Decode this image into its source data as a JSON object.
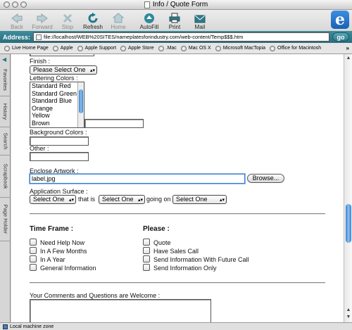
{
  "window": {
    "title": "Info / Quote Form"
  },
  "toolbar": {
    "back": "Back",
    "forward": "Forward",
    "stop": "Stop",
    "refresh": "Refresh",
    "home": "Home",
    "autofill": "AutoFill",
    "print": "Print",
    "mail": "Mail"
  },
  "address": {
    "label": "Address:",
    "url": "file://localhost/WEB%20SITES/nameplatesforindustry.com/web-content/Temp$$$.htm",
    "go": "go"
  },
  "favorites": [
    "Live Home Page",
    "Apple",
    "Apple Support",
    "Apple Store",
    ".Mac",
    "Mac OS X",
    "Microsoft MacTopia",
    "Office for Macintosh"
  ],
  "sidebar_tabs": [
    "Favorites",
    "History",
    "Search",
    "Scrapbook",
    "Page Holder"
  ],
  "form": {
    "finish_label": "Finish :",
    "finish_value": "Please Select One",
    "lettering_label": "Lettering Colors :",
    "lettering_options": [
      "Standard Red",
      "Standard Green",
      "Standard Blue",
      "Orange",
      "Yellow",
      "Brown"
    ],
    "background_label": "Background Colors :",
    "other_label": "Other :",
    "artwork_label": "Enclose Artwork :",
    "artwork_value": "label.jpg",
    "browse": "Browse...",
    "surface_label": "Application Surface :",
    "surface_select_1": "Select One",
    "that_is": "that is",
    "surface_select_2": "Select One",
    "going_on": "going on",
    "surface_select_3": "Select One",
    "timeframe_heading": "Time Frame :",
    "timeframe_options": [
      "Need Help Now",
      "In A Few Months",
      "In A Year",
      "General Information"
    ],
    "please_heading": "Please :",
    "please_options": [
      "Quote",
      "Have Sales Call",
      "Send Information With Future Call",
      "Send Information Only"
    ],
    "comments_label": "Your Comments and Questions are Welcome :"
  },
  "status": {
    "zone": "Local machine zone"
  }
}
